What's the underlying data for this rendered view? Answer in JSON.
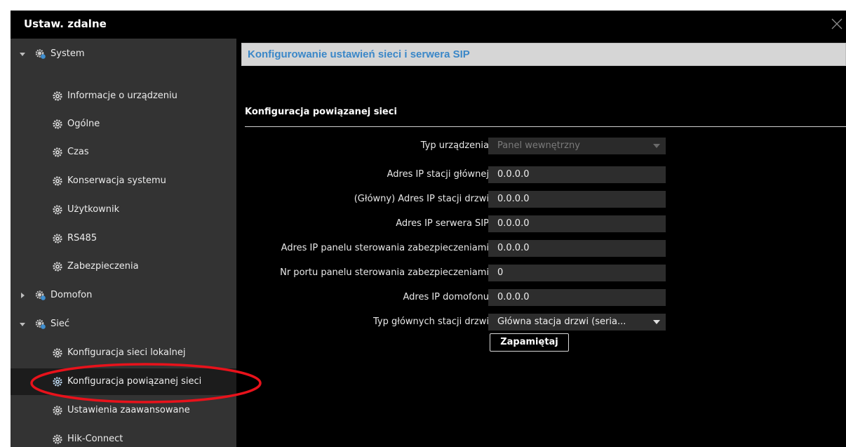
{
  "window": {
    "title": "Ustaw. zdalne"
  },
  "sidebar": {
    "items": [
      {
        "label": "System",
        "level": 0,
        "expanded": true
      },
      {
        "label": "Informacje o urządzeniu",
        "level": 1
      },
      {
        "label": "Ogólne",
        "level": 1
      },
      {
        "label": "Czas",
        "level": 1
      },
      {
        "label": "Konserwacja systemu",
        "level": 1
      },
      {
        "label": "Użytkownik",
        "level": 1
      },
      {
        "label": "RS485",
        "level": 1
      },
      {
        "label": "Zabezpieczenia",
        "level": 1
      },
      {
        "label": "Domofon",
        "level": 0,
        "expanded": false
      },
      {
        "label": "Sieć",
        "level": 0,
        "expanded": true
      },
      {
        "label": "Konfiguracja sieci lokalnej",
        "level": 1
      },
      {
        "label": "Konfiguracja powiązanej sieci",
        "level": 1,
        "selected": true
      },
      {
        "label": "Ustawienia zaawansowane",
        "level": 1
      },
      {
        "label": "Hik-Connect",
        "level": 1
      }
    ]
  },
  "main": {
    "section_title": "Konfigurowanie ustawień sieci i serwera SIP",
    "subheading": "Konfiguracja powiązanej sieci",
    "fields": [
      {
        "label": "Typ urządzenia",
        "value": "Panel wewnętrzny"
      },
      {
        "label": "Adres IP stacji głównej",
        "value": "0.0.0.0"
      },
      {
        "label": "(Główny) Adres IP stacji drzwi",
        "value": "0.0.0.0"
      },
      {
        "label": "Adres IP serwera SIP",
        "value": "0.0.0.0"
      },
      {
        "label": "Adres IP panelu sterowania zabezpieczeniami",
        "value": "0.0.0.0"
      },
      {
        "label": "Nr portu panelu sterowania zabezpieczeniami",
        "value": "0"
      },
      {
        "label": "Adres IP domofonu",
        "value": "0.0.0.0"
      },
      {
        "label": "Typ głównych stacji drzwi",
        "value": "Główna stacja drzwi (seria..."
      }
    ],
    "save_label": "Zapamiętaj"
  },
  "colors": {
    "background": "#000000",
    "sidebar": "#333333",
    "selected_row": "#1c1c1c",
    "section_header_bg": "#d6d6d6",
    "section_header_text": "#3a87c8",
    "field_bg": "#2d2d2d",
    "highlight": "#e8121b"
  },
  "icons": {
    "group": "gear-group-icon",
    "item": "gear-icon",
    "close": "close-icon",
    "expanded": "caret-down-icon",
    "collapsed": "caret-right-icon"
  }
}
